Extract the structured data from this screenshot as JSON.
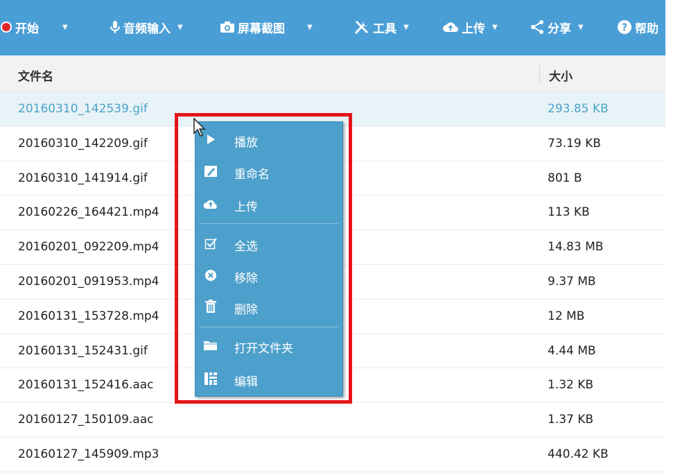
{
  "toolbar": {
    "items": [
      {
        "label": "开始",
        "icon": "record-dot-icon"
      },
      {
        "label": "音频输入",
        "icon": "microphone-icon"
      },
      {
        "label": "屏幕截图",
        "icon": "camera-icon"
      },
      {
        "label": "工具",
        "icon": "tools-icon"
      },
      {
        "label": "上传",
        "icon": "cloud-upload-icon"
      },
      {
        "label": "分享",
        "icon": "share-icon"
      },
      {
        "label": "帮助",
        "icon": "help-icon"
      }
    ],
    "caret": "▼"
  },
  "table": {
    "col_name": "文件名",
    "col_size": "大小",
    "rows": [
      {
        "name": "20160310_142539.gif",
        "size": "293.85 KB",
        "selected": true
      },
      {
        "name": "20160310_142209.gif",
        "size": "73.19 KB"
      },
      {
        "name": "20160310_141914.gif",
        "size": "801 B"
      },
      {
        "name": "20160226_164421.mp4",
        "size": "113 KB"
      },
      {
        "name": "20160201_092209.mp4",
        "size": "14.83 MB"
      },
      {
        "name": "20160201_091953.mp4",
        "size": "9.37 MB"
      },
      {
        "name": "20160131_153728.mp4",
        "size": "12 MB"
      },
      {
        "name": "20160131_152431.gif",
        "size": "4.44 MB"
      },
      {
        "name": "20160131_152416.aac",
        "size": "1.32 KB"
      },
      {
        "name": "20160127_150109.aac",
        "size": "1.37 KB"
      },
      {
        "name": "20160127_145909.mp3",
        "size": "440.42 KB"
      }
    ]
  },
  "context_menu": {
    "items": [
      {
        "label": "播放",
        "icon": "play-icon"
      },
      {
        "label": "重命名",
        "icon": "rename-icon"
      },
      {
        "label": "上传",
        "icon": "cloud-upload-icon"
      },
      {
        "label": "全选",
        "icon": "select-all-icon"
      },
      {
        "label": "移除",
        "icon": "remove-icon"
      },
      {
        "label": "删除",
        "icon": "trash-icon"
      },
      {
        "label": "打开文件夹",
        "icon": "folder-icon"
      },
      {
        "label": "编辑",
        "icon": "edit-icon"
      }
    ]
  },
  "colors": {
    "toolbar": "#4a9ed6",
    "menu": "#4da0cb",
    "highlight": "#e3151a",
    "selected_text": "#4aa3c8",
    "record": "#e0262b"
  }
}
